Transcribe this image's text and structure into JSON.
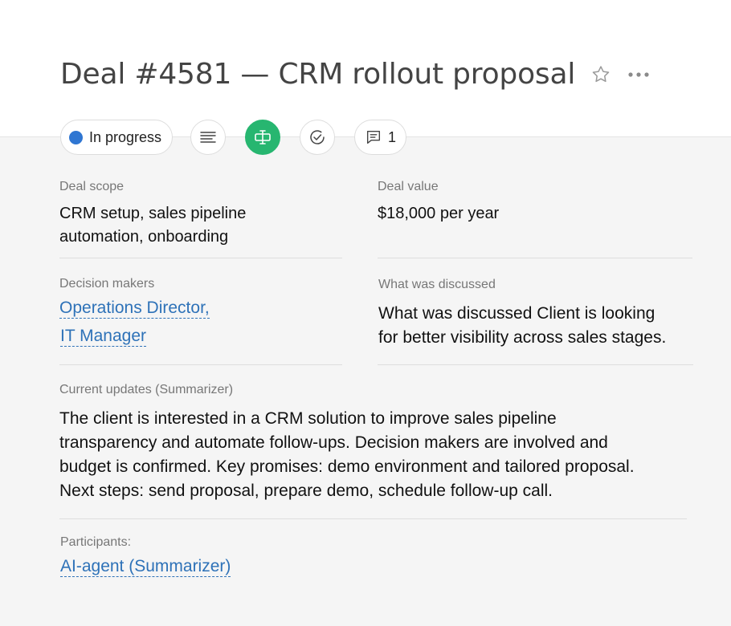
{
  "header": {
    "title": "Deal #4581 — CRM rollout proposal",
    "star_icon": "star-outline-icon",
    "more_icon": "more-horizontal-icon"
  },
  "toolbar": {
    "status_label": "In progress",
    "status_color": "#2f76d2",
    "comments_count": "1",
    "active_color": "#27b670",
    "icons": [
      "description-lines-icon",
      "fields-icon",
      "check-circle-icon",
      "comment-icon"
    ]
  },
  "fields": {
    "scope": {
      "label": "Deal scope",
      "value_line1": "CRM setup, sales pipeline",
      "value_line2": "automation, onboarding"
    },
    "value": {
      "label": "Deal value",
      "value": "$18,000 per year"
    },
    "decision_makers": {
      "label": "Decision makers",
      "items": [
        "Operations Director,",
        "IT Manager"
      ]
    },
    "discussed": {
      "label": "What was discussed",
      "value_line1": "What was discussed Client is looking",
      "value_line2": "for better visibility across sales stages."
    },
    "updates": {
      "label": "Current updates (Summarizer)",
      "lines": [
        "The client is interested in a CRM solution to improve sales pipeline",
        "transparency and automate follow-ups. Decision makers are involved and",
        "budget is confirmed. Key promises: demo environment and tailored proposal.",
        "Next steps: send proposal, prepare demo, schedule follow-up call."
      ]
    },
    "participants": {
      "label": "Participants:",
      "items": [
        "AI-agent (Summarizer)"
      ]
    }
  }
}
